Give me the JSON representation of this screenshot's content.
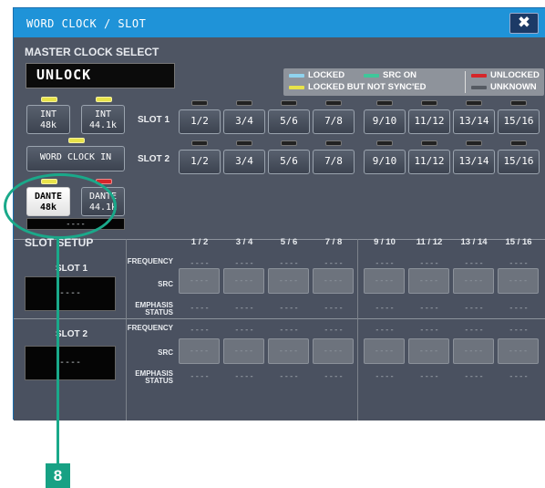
{
  "window": {
    "title": "WORD CLOCK / SLOT",
    "close_glyph": "✖"
  },
  "master_clock": {
    "heading": "MASTER CLOCK SELECT",
    "status": "UNLOCK",
    "legend": {
      "locked": "LOCKED",
      "src_on": "SRC ON",
      "locked_not_synced": "LOCKED BUT NOT SYNC'ED",
      "unlocked": "UNLOCKED",
      "unknown": "UNKNOWN",
      "colors": {
        "locked": "#8fd3ee",
        "src_on": "#3fc79a",
        "locked_not_synced": "#e8e34a",
        "unlocked": "#d6262a",
        "unknown": "#555a62"
      }
    },
    "int_buttons": [
      {
        "line1": "INT",
        "line2": "48k",
        "led": "yellow"
      },
      {
        "line1": "INT",
        "line2": "44.1k",
        "led": "yellow"
      }
    ],
    "word_clock_in": {
      "label": "WORD CLOCK IN",
      "led": "yellow"
    },
    "dante_buttons": [
      {
        "line1": "DANTE",
        "line2": "48k",
        "led": "yellow",
        "selected": true
      },
      {
        "line1": "DANTE",
        "line2": "44.1k",
        "led": "red",
        "selected": false
      }
    ],
    "dante_status": "----",
    "slot_rows": [
      {
        "label": "SLOT 1",
        "pairs": [
          "1/2",
          "3/4",
          "5/6",
          "7/8",
          "9/10",
          "11/12",
          "13/14",
          "15/16"
        ]
      },
      {
        "label": "SLOT 2",
        "pairs": [
          "1/2",
          "3/4",
          "5/6",
          "7/8",
          "9/10",
          "11/12",
          "13/14",
          "15/16"
        ]
      }
    ]
  },
  "slot_setup": {
    "heading": "SLOT SETUP",
    "columns": [
      "1 / 2",
      "3 / 4",
      "5 / 6",
      "7 / 8",
      "9 / 10",
      "11 / 12",
      "13 / 14",
      "15 / 16"
    ],
    "row_labels": {
      "frequency": "FREQUENCY",
      "src": "SRC",
      "emphasis_1": "EMPHASIS",
      "emphasis_2": "STATUS"
    },
    "placeholder": "----",
    "slots": [
      {
        "label": "SLOT 1",
        "status": "----"
      },
      {
        "label": "SLOT 2",
        "status": "----"
      }
    ]
  },
  "callout": {
    "number": "8"
  }
}
